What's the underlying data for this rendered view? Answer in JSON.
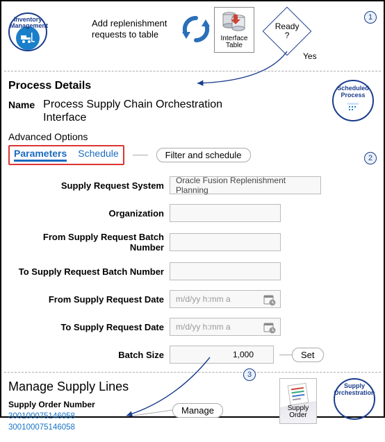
{
  "section1": {
    "inventory_label": "Inventory\nManagement",
    "add_text": "Add replenishment requests to table",
    "interface_box": "Interface\nTable",
    "decision_label": "Ready\n?",
    "decision_yes": "Yes",
    "step": "1"
  },
  "section2": {
    "step": "2",
    "pd_title": "Process Details",
    "name_label": "Name",
    "name_value": "Process Supply Chain Orchestration Interface",
    "advanced": "Advanced Options",
    "tabs": {
      "parameters": "Parameters",
      "schedule": "Schedule"
    },
    "tabs_callout": "Filter and schedule",
    "scheduled_label": "Scheduled\nProcess",
    "fields": {
      "srs": {
        "label": "Supply Request System",
        "value": "Oracle Fusion Replenishment Planning"
      },
      "org": {
        "label": "Organization",
        "value": ""
      },
      "from_batch": {
        "label": "From Supply Request Batch Number",
        "value": ""
      },
      "to_batch": {
        "label": "To Supply Request Batch Number",
        "value": ""
      },
      "from_date": {
        "label": "From Supply Request Date",
        "placeholder": "m/d/yy h:mm a"
      },
      "to_date": {
        "label": "To Supply Request Date",
        "placeholder": "m/d/yy h:mm a"
      },
      "batch_size": {
        "label": "Batch Size",
        "value": "1,000"
      }
    },
    "set_callout": "Set"
  },
  "section3": {
    "step": "3",
    "title": "Manage Supply Lines",
    "son_label": "Supply Order Number",
    "orders": [
      "300100075146058",
      "300100075146058"
    ],
    "manage_callout": "Manage",
    "supply_box": "Supply\nOrder",
    "orch_label": "Supply\nOrchestration"
  }
}
